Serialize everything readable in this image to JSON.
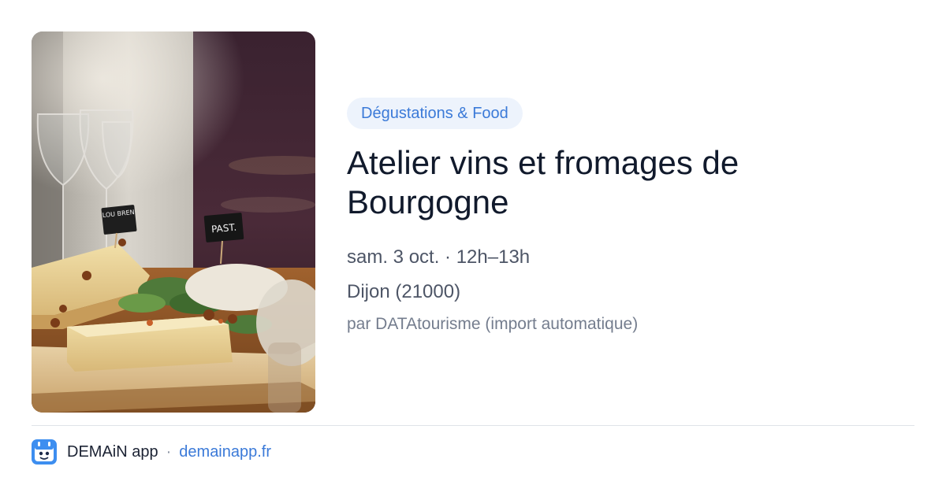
{
  "event": {
    "category": "Dégustations & Food",
    "title": "Atelier vins et fromages de Bourgogne",
    "datetime": "sam. 3 oct. · 12h–13h",
    "location": "Dijon (21000)",
    "source": "par DATAtourisme (import automatique)",
    "photo_signs": [
      "LOU BREN",
      "PAST."
    ]
  },
  "footer": {
    "app_name": "DEMAiN app",
    "separator": "·",
    "domain": "demainapp.fr",
    "app_icon": "demain-app-icon"
  },
  "colors": {
    "accent": "#3b7ad8",
    "tag_background": "#edf3fc",
    "title": "#111a2c"
  }
}
